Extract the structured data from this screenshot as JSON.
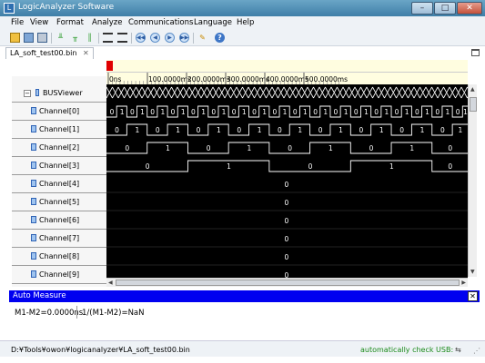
{
  "window": {
    "title": "LogicAnalyzer Software",
    "controls": {
      "minimize": "–",
      "maximize": "□",
      "close": "✕"
    }
  },
  "menu": [
    "File",
    "View",
    "Format",
    "Analyze",
    "Communications",
    "Language",
    "Help"
  ],
  "toolbar": {
    "icons": [
      "open-folder-icon",
      "save-icon",
      "print-icon",
      "trigger-icon",
      "rising-edge-icon",
      "bar-icon",
      "grid-lines-icon",
      "list-lines-icon",
      "nav-first-icon",
      "nav-prev-icon",
      "nav-next-icon",
      "nav-last-icon",
      "wand-icon",
      "help-icon"
    ],
    "help_glyph": "?"
  },
  "document_tab": {
    "label": "LA_soft_test00.bin",
    "close": "✕"
  },
  "time_ruler": {
    "labels": [
      "0ns",
      "100.0000ms",
      "200.0000ms",
      "300.0000ms",
      "400.0000ms",
      "500.0000ms"
    ]
  },
  "channels": {
    "bus": {
      "label": "BUSViewer",
      "expander": "−"
    },
    "list": [
      {
        "label": "Channel[0]"
      },
      {
        "label": "Channel[1]"
      },
      {
        "label": "Channel[2]"
      },
      {
        "label": "Channel[3]"
      },
      {
        "label": "Channel[4]"
      },
      {
        "label": "Channel[5]"
      },
      {
        "label": "Channel[6]"
      },
      {
        "label": "Channel[7]"
      },
      {
        "label": "Channel[8]"
      },
      {
        "label": "Channel[9]"
      }
    ]
  },
  "waveforms": {
    "digital": [
      {
        "bit_period_ms": 26,
        "start_level": 0
      },
      {
        "bit_period_ms": 52,
        "start_level": 0
      },
      {
        "bit_period_ms": 104,
        "start_level": 0
      },
      {
        "bit_period_ms": 208,
        "start_level": 0
      }
    ],
    "constant_value": "0"
  },
  "auto_measure": {
    "title": "Auto Measure",
    "close": "✕",
    "m1_m2": "M1-M2=0.0000ns",
    "inverse": "1/(M1-M2)=NaN"
  },
  "status": {
    "path": "D:¥Tools¥owon¥logicanalyzer¥LA_soft_test00.bin",
    "usb": "automatically check USB:",
    "usb_icon": "⇆"
  },
  "colors": {
    "wave_bg": "#000000",
    "wave_line": "#ffffff",
    "auto_bar": "#0000f0",
    "marker": "#e00000"
  }
}
